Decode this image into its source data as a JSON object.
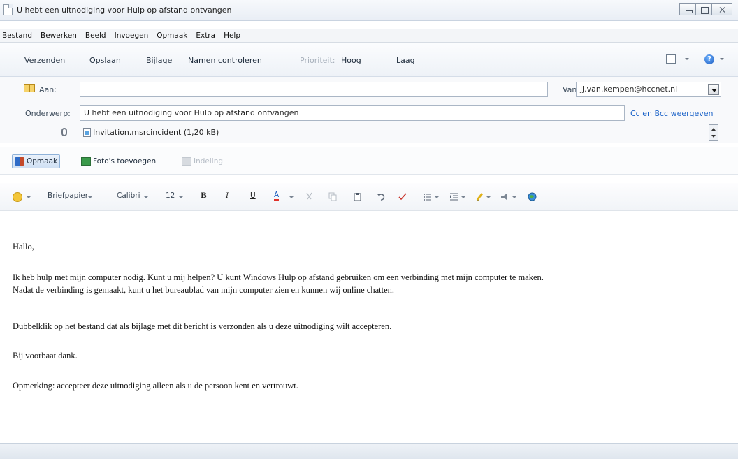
{
  "window": {
    "title": "U hebt een uitnodiging voor Hulp op afstand ontvangen"
  },
  "menu": [
    "Bestand",
    "Bewerken",
    "Beeld",
    "Invoegen",
    "Opmaak",
    "Extra",
    "Help"
  ],
  "toolbar": {
    "send": "Verzenden",
    "save": "Opslaan",
    "attach": "Bijlage",
    "check_names": "Namen controleren",
    "priority": "Prioriteit:",
    "high": "Hoog",
    "low": "Laag"
  },
  "fields": {
    "to_label": "Aan:",
    "to_value": "",
    "from_label": "Van:",
    "from_value": "jj.van.kempen@hccnet.nl",
    "subject_label": "Onderwerp:",
    "subject_value": "U hebt een uitnodiging voor Hulp op afstand ontvangen",
    "cc_bcc_link": "Cc en Bcc weergeven",
    "attachment": "Invitation.msrcincident (1,20 kB)"
  },
  "toolbar2": {
    "format": "Opmaak",
    "add_photos": "Foto's toevoegen",
    "layout": "Indeling"
  },
  "format_bar": {
    "stationery": "Briefpapier",
    "font": "Calibri",
    "size": "12",
    "bold": "B",
    "italic": "I",
    "underline": "U",
    "font_color": "A"
  },
  "body": {
    "greeting": "Hallo,",
    "para1_line1": "Ik heb hulp met mijn computer nodig. Kunt u mij helpen? U kunt Windows Hulp op afstand gebruiken om een verbinding met mijn computer te maken.",
    "para1_line2": "Nadat de verbinding is gemaakt, kunt u het bureaublad van mijn computer zien en kunnen wij online chatten.",
    "para2": "Dubbelklik op het bestand dat als bijlage met dit bericht is verzonden als u deze uitnodiging wilt accepteren.",
    "para3": "Bij voorbaat dank.",
    "para4": "Opmerking: accepteer deze uitnodiging alleen als u de persoon kent en vertrouwt."
  },
  "colors": {
    "link": "#1a62c8",
    "accent": "#8fb2d9"
  }
}
